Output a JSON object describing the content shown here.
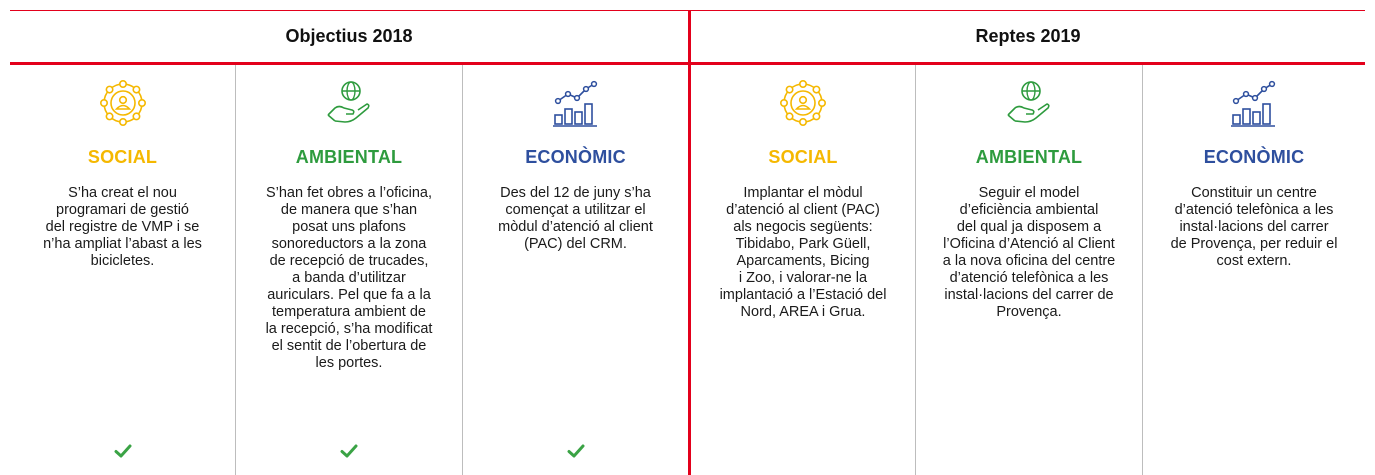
{
  "headers": {
    "left": "Objectius 2018",
    "right": "Reptes 2019"
  },
  "colors": {
    "accent_red": "#e3001b",
    "social": "#f5b800",
    "ambiental": "#2e9b3e",
    "economic": "#2e4f9e",
    "check": "#3aa345"
  },
  "objectius": [
    {
      "icon": "people-network-icon",
      "title": "SOCIAL",
      "lines": [
        "S’ha creat el nou",
        "programari de gestió",
        "del registre de VMP i se",
        "n’ha ampliat l’abast a les",
        "bicicletes."
      ],
      "done": true
    },
    {
      "icon": "globe-hand-icon",
      "title": "AMBIENTAL",
      "lines": [
        "S’han fet obres a l’oficina,",
        "de manera que s’han",
        "posat uns plafons",
        "sonoreductors a la zona",
        "de recepció de trucades,",
        "a banda d’utilitzar",
        "auriculars. Pel que fa a la",
        "temperatura ambient de",
        "la recepció, s’ha modificat",
        "el sentit de l’obertura de",
        "les portes."
      ],
      "done": true
    },
    {
      "icon": "growth-chart-icon",
      "title": "ECONÒMIC",
      "lines": [
        "Des del 12 de juny s’ha",
        "començat a utilitzar el",
        "mòdul d’atenció al client",
        "(PAC) del CRM."
      ],
      "done": true
    }
  ],
  "reptes": [
    {
      "icon": "people-network-icon",
      "title": "SOCIAL",
      "lines": [
        "Implantar el mòdul",
        "d’atenció al client (PAC)",
        "als negocis següents:",
        "Tibidabo, Park Güell,",
        "Aparcaments, Bicing",
        "i Zoo, i valorar-ne la",
        "implantació a l’Estació del",
        "Nord, AREA i Grua."
      ]
    },
    {
      "icon": "globe-hand-icon",
      "title": "AMBIENTAL",
      "lines": [
        "Seguir el model",
        "d’eficiència ambiental",
        "del qual ja disposem a",
        "l’Oficina d’Atenció al Client",
        "a la nova oficina del centre",
        "d’atenció telefònica a les",
        "instal·lacions del carrer de",
        "Provença."
      ]
    },
    {
      "icon": "growth-chart-icon",
      "title": "ECONÒMIC",
      "lines": [
        "Constituir un centre",
        "d’atenció telefònica a les",
        "instal·lacions del carrer",
        "de Provença, per reduir el",
        "cost extern."
      ]
    }
  ]
}
